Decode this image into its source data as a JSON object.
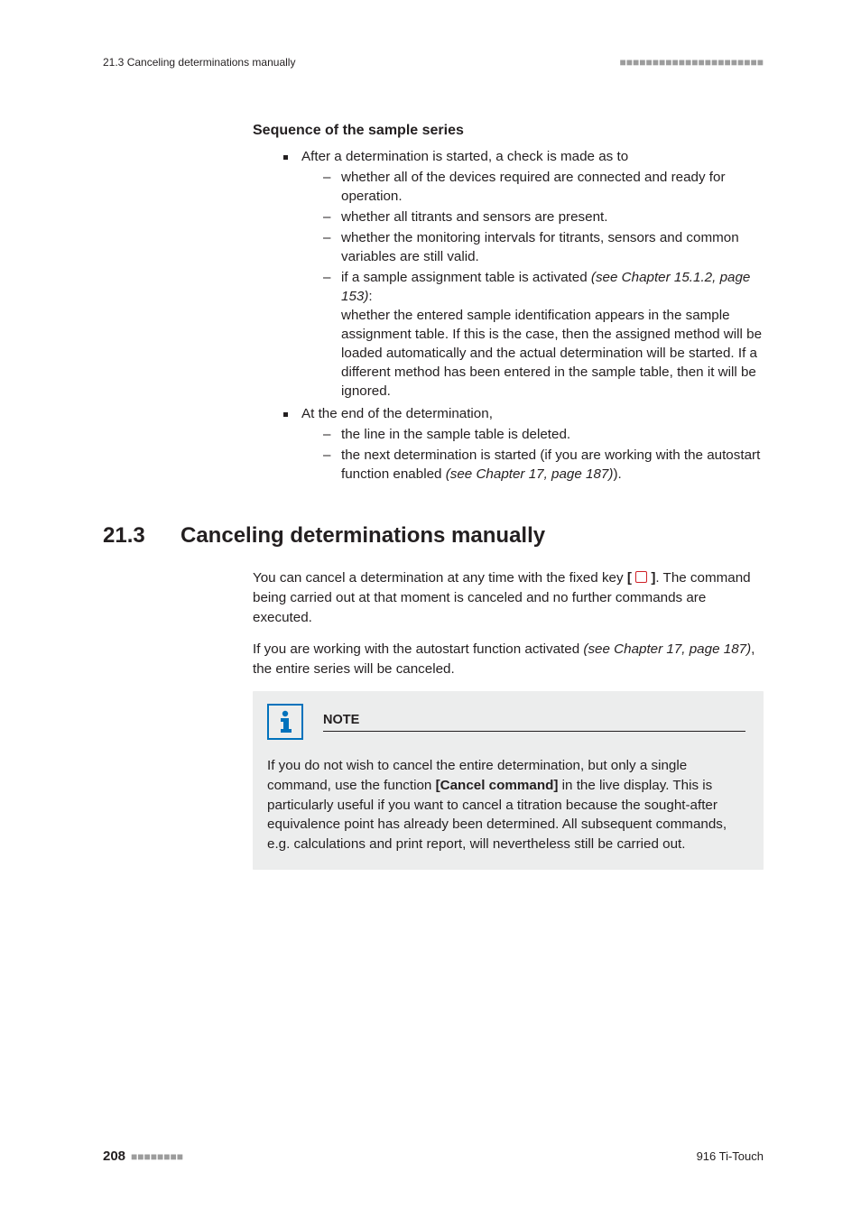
{
  "running_head": {
    "left": "21.3 Canceling determinations manually",
    "right": "■■■■■■■■■■■■■■■■■■■■■■"
  },
  "sequence": {
    "heading": "Sequence of the sample series",
    "item1_intro": "After a determination is started, a check is made as to",
    "item1_sub1": "whether all of the devices required are connected and ready for operation.",
    "item1_sub2": "whether all titrants and sensors are present.",
    "item1_sub3": "whether the monitoring intervals for titrants, sensors and common variables are still valid.",
    "item1_sub4_a": "if a sample assignment table is activated ",
    "item1_sub4_ref": "(see Chapter 15.1.2, page 153)",
    "item1_sub4_b": ":",
    "item1_sub4_body": "whether the entered sample identification appears in the sample assignment table. If this is the case, then the assigned method will be loaded automatically and the actual determination will be started. If a different method has been entered in the sample table, then it will be ignored.",
    "item2_intro": "At the end of the determination,",
    "item2_sub1": "the line in the sample table is deleted.",
    "item2_sub2_a": "the next determination is started (if you are working with the autostart function enabled ",
    "item2_sub2_ref": "(see Chapter 17, page 187)",
    "item2_sub2_b": ")."
  },
  "section": {
    "number": "21.3",
    "title": "Canceling determinations manually"
  },
  "para1_a": "You can cancel a determination at any time with the fixed key ",
  "para1_b": ". The command being carried out at that moment is canceled and no further commands are executed.",
  "para2_a": "If you are working with the autostart function activated ",
  "para2_ref": "(see Chapter 17, page 187)",
  "para2_b": ", the entire series will be canceled.",
  "note": {
    "label": "NOTE",
    "body_a": "If you do not wish to cancel the entire determination, but only a single command, use the function ",
    "body_bold": "[Cancel command]",
    "body_b": " in the live display. This is particularly useful if you want to cancel a titration because the sought-after equivalence point has already been determined. All subsequent commands, e.g. calculations and print report, will nevertheless still be carried out."
  },
  "footer": {
    "page": "208",
    "dashes": "■■■■■■■■",
    "right": "916 Ti-Touch"
  }
}
